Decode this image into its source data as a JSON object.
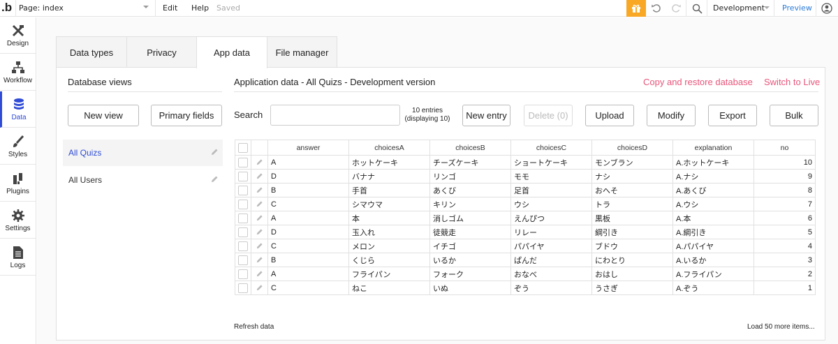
{
  "topbar": {
    "logo": ".b",
    "page": "Page: index",
    "menu": [
      "Edit",
      "Help"
    ],
    "saved": "Saved",
    "environment": "Development",
    "preview": "Preview",
    "accent": "#f9a825"
  },
  "rail": {
    "items": [
      {
        "label": "Design",
        "icon": "design-icon"
      },
      {
        "label": "Workflow",
        "icon": "workflow-icon"
      },
      {
        "label": "Data",
        "icon": "data-icon"
      },
      {
        "label": "Styles",
        "icon": "styles-icon"
      },
      {
        "label": "Plugins",
        "icon": "plugins-icon"
      },
      {
        "label": "Settings",
        "icon": "settings-icon"
      },
      {
        "label": "Logs",
        "icon": "logs-icon"
      }
    ],
    "active": "Data",
    "active_color": "#2f4bd6"
  },
  "tabs": [
    {
      "label": "Data types"
    },
    {
      "label": "Privacy"
    },
    {
      "label": "App data"
    },
    {
      "label": "File manager"
    }
  ],
  "database_views": {
    "title": "Database views",
    "new_view": "New view",
    "primary_fields": "Primary fields",
    "items": [
      {
        "label": "All Quizs"
      },
      {
        "label": "All Users"
      }
    ]
  },
  "app_data": {
    "title": "Application data - All Quizs - Development version",
    "copy_restore": "Copy and restore database",
    "switch_live": "Switch to Live",
    "search_label": "Search",
    "search_value": "",
    "entries_line1": "10 entries",
    "entries_line2": "(displaying 10)",
    "buttons": {
      "new_entry": "New entry",
      "delete": "Delete (0)",
      "upload": "Upload",
      "modify": "Modify",
      "export": "Export",
      "bulk": "Bulk"
    },
    "columns": [
      "answer",
      "choicesA",
      "choicesB",
      "choicesC",
      "choicesD",
      "explanation",
      "no"
    ],
    "rows": [
      [
        "A",
        "ホットケーキ",
        "チーズケーキ",
        "ショートケーキ",
        "モンブラン",
        "A.ホットケーキ",
        "10"
      ],
      [
        "D",
        "バナナ",
        "リンゴ",
        "モモ",
        "ナシ",
        "A.ナシ",
        "9"
      ],
      [
        "B",
        "手首",
        "あくび",
        "足首",
        "おへそ",
        "A.あくび",
        "8"
      ],
      [
        "C",
        "シマウマ",
        "キリン",
        "ウシ",
        "トラ",
        "A.ウシ",
        "7"
      ],
      [
        "A",
        "本",
        "消しゴム",
        "えんぴつ",
        "黒板",
        "A.本",
        "6"
      ],
      [
        "D",
        "玉入れ",
        "徒競走",
        "リレー",
        "綱引き",
        "A.綱引き",
        "5"
      ],
      [
        "C",
        "メロン",
        "イチゴ",
        "パパイヤ",
        "ブドウ",
        "A.パパイヤ",
        "4"
      ],
      [
        "B",
        "くじら",
        "いるか",
        "ぱんだ",
        "にわとり",
        "A.いるか",
        "3"
      ],
      [
        "A",
        "フライパン",
        "フォーク",
        "おなべ",
        "おはし",
        "A.フライパン",
        "2"
      ],
      [
        "C",
        "ねこ",
        "いぬ",
        "ぞう",
        "うさぎ",
        "A.ぞう",
        "1"
      ]
    ],
    "refresh": "Refresh data",
    "load_more": "Load 50 more items...",
    "link_color": "#e8557a"
  }
}
